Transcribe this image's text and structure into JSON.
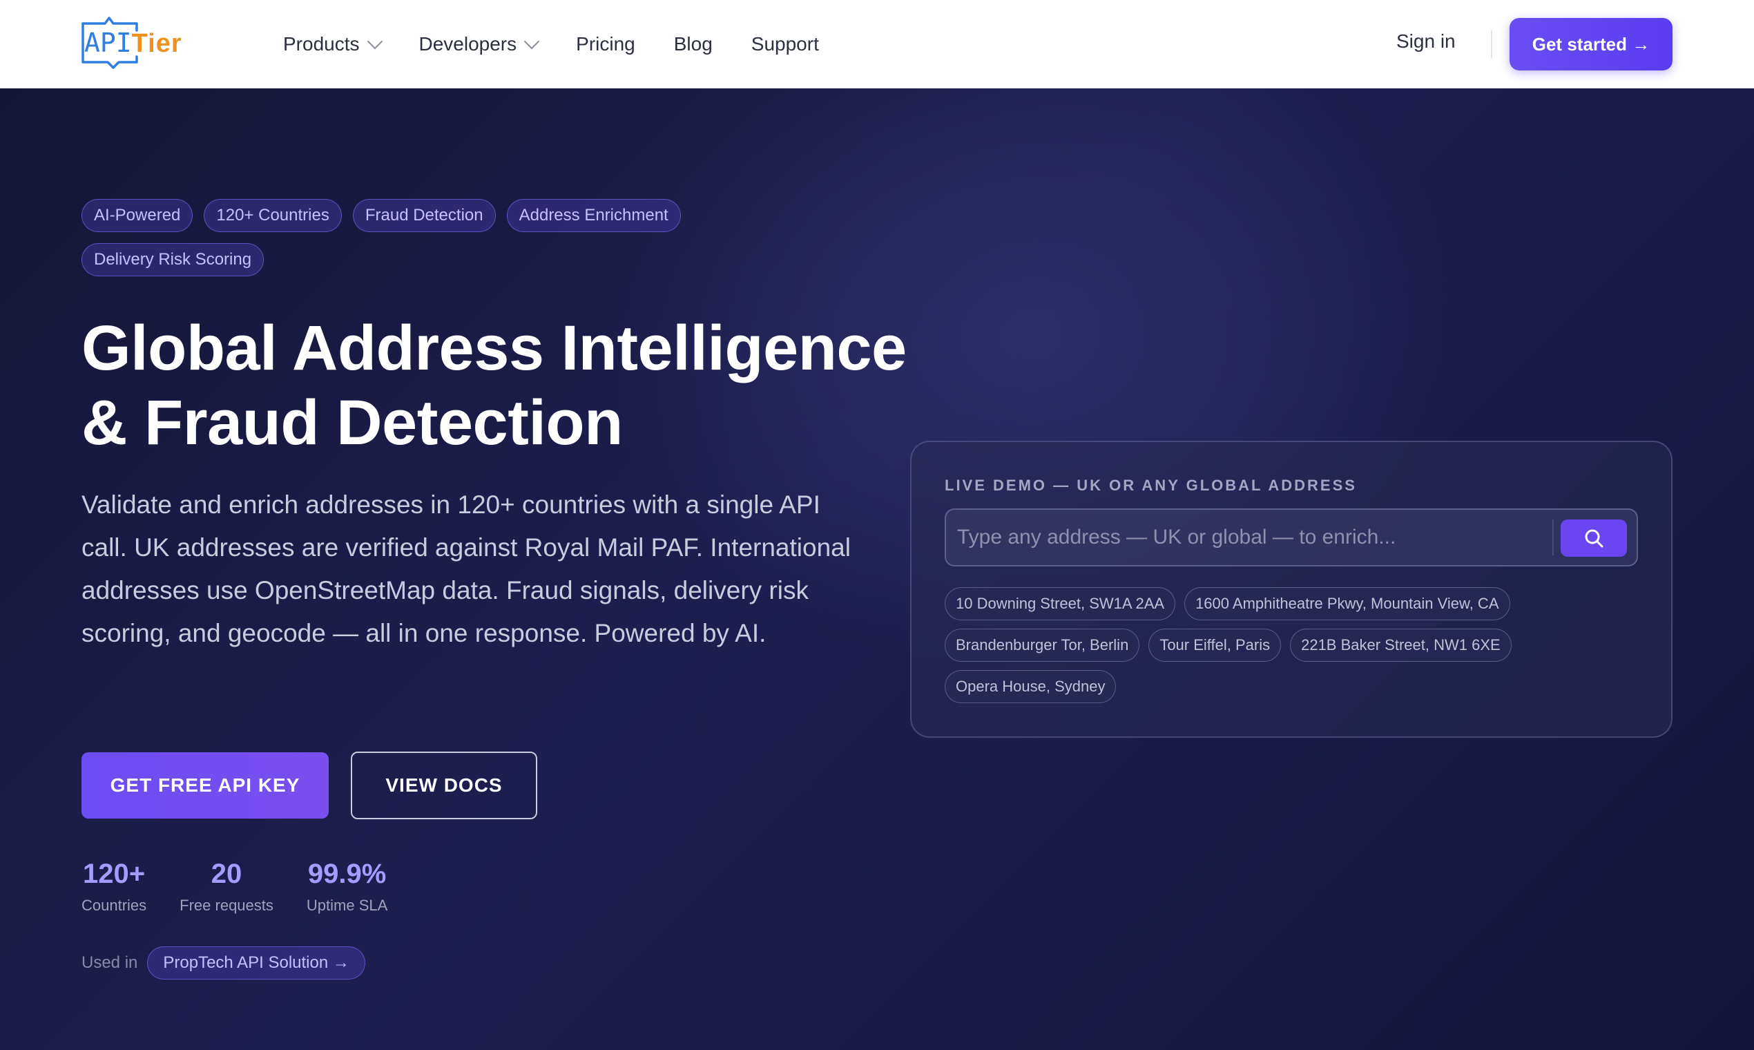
{
  "header": {
    "logo": {
      "part1": "API",
      "part2": "Tier"
    },
    "nav": [
      {
        "label": "Products",
        "has_dropdown": true
      },
      {
        "label": "Developers",
        "has_dropdown": true
      },
      {
        "label": "Pricing",
        "has_dropdown": false
      },
      {
        "label": "Blog",
        "has_dropdown": false
      },
      {
        "label": "Support",
        "has_dropdown": false
      }
    ],
    "sign_in": "Sign in",
    "cta": "Get started →"
  },
  "hero": {
    "tags": [
      "AI-Powered",
      "120+ Countries",
      "Fraud Detection",
      "Address Enrichment",
      "Delivery Risk Scoring"
    ],
    "title_line1": "Global Address Intelligence",
    "title_line2": "& Fraud Detection",
    "subtitle": "Validate and enrich addresses in 120+ countries with a single API call. UK addresses are verified against Royal Mail PAF. International addresses use OpenStreetMap data. Fraud signals, delivery risk scoring, and geocode — all in one response. Powered by AI.",
    "primary_button": "GET FREE API KEY",
    "secondary_button": "VIEW DOCS",
    "stats": [
      {
        "value": "120+",
        "label": "Countries"
      },
      {
        "value": "20",
        "label": "Free requests"
      },
      {
        "value": "99.9%",
        "label": "Uptime SLA"
      }
    ],
    "used_in_label": "Used in",
    "used_in_link": "PropTech API Solution →"
  },
  "demo": {
    "label": "LIVE DEMO — UK OR ANY GLOBAL ADDRESS",
    "input_value": "",
    "placeholder": "Type any address — UK or global — to enrich...",
    "examples": [
      "10 Downing Street, SW1A 2AA",
      "1600 Amphitheatre Pkwy, Mountain View, CA",
      "Brandenburger Tor, Berlin",
      "Tour Eiffel, Paris",
      "221B Baker Street, NW1 6XE",
      "Opera House, Sydney"
    ]
  },
  "colors": {
    "accent": "#6a45f0",
    "logo_blue": "#2f7fe0",
    "logo_orange": "#f0901e",
    "hero_bg": "#1b1c4a",
    "stat_value": "#a59cff"
  },
  "icons": {
    "logo": "speech-bubble-logo-icon",
    "dropdown": "chevron-down-icon",
    "search": "search-icon"
  }
}
